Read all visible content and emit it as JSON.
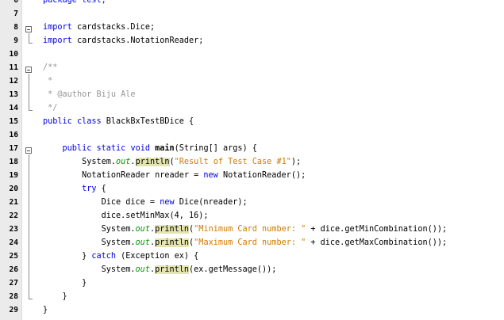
{
  "editor": {
    "lines": [
      {
        "n": "6",
        "tokens": [
          {
            "t": "package test;",
            "c": "kw-partial"
          }
        ]
      },
      {
        "n": "7",
        "tokens": []
      },
      {
        "n": "8",
        "tokens": [
          {
            "t": "import",
            "c": "kw"
          },
          {
            "t": " cardstacks.Dice;",
            "c": ""
          }
        ]
      },
      {
        "n": "9",
        "tokens": [
          {
            "t": "import",
            "c": "kw"
          },
          {
            "t": " cardstacks.NotationReader;",
            "c": ""
          }
        ]
      },
      {
        "n": "10",
        "tokens": []
      },
      {
        "n": "11",
        "tokens": [
          {
            "t": "/**",
            "c": "cmt"
          }
        ]
      },
      {
        "n": "12",
        "tokens": [
          {
            "t": " *",
            "c": "cmt"
          }
        ]
      },
      {
        "n": "13",
        "tokens": [
          {
            "t": " * ",
            "c": "cmt"
          },
          {
            "t": "@author",
            "c": "tag"
          },
          {
            "t": " Biju Ale",
            "c": "cmt"
          }
        ]
      },
      {
        "n": "14",
        "tokens": [
          {
            "t": " */",
            "c": "cmt"
          }
        ]
      },
      {
        "n": "15",
        "tokens": [
          {
            "t": "public",
            "c": "kw"
          },
          {
            "t": " ",
            "c": ""
          },
          {
            "t": "class",
            "c": "kw"
          },
          {
            "t": " BlackBxTestBDice {",
            "c": ""
          }
        ]
      },
      {
        "n": "16",
        "tokens": []
      },
      {
        "n": "17",
        "tokens": [
          {
            "t": "    public",
            "c": "kw"
          },
          {
            "t": " ",
            "c": ""
          },
          {
            "t": "static",
            "c": "kw"
          },
          {
            "t": " ",
            "c": ""
          },
          {
            "t": "void",
            "c": "kw"
          },
          {
            "t": " ",
            "c": ""
          },
          {
            "t": "main",
            "c": "bold"
          },
          {
            "t": "(String[] args) {",
            "c": ""
          }
        ]
      },
      {
        "n": "18",
        "tokens": [
          {
            "t": "        System.",
            "c": ""
          },
          {
            "t": "out",
            "c": "fld"
          },
          {
            "t": ".",
            "c": ""
          },
          {
            "t": "println",
            "c": "hl"
          },
          {
            "t": "(",
            "c": ""
          },
          {
            "t": "\"Result of Test Case #1\"",
            "c": "str"
          },
          {
            "t": ");",
            "c": ""
          }
        ]
      },
      {
        "n": "19",
        "tokens": [
          {
            "t": "        NotationReader nreader = ",
            "c": ""
          },
          {
            "t": "new",
            "c": "kw"
          },
          {
            "t": " NotationReader();",
            "c": ""
          }
        ]
      },
      {
        "n": "20",
        "tokens": [
          {
            "t": "        try",
            "c": "kw"
          },
          {
            "t": " {",
            "c": ""
          }
        ]
      },
      {
        "n": "21",
        "tokens": [
          {
            "t": "            Dice dice = ",
            "c": ""
          },
          {
            "t": "new",
            "c": "kw"
          },
          {
            "t": " Dice(nreader);",
            "c": ""
          }
        ]
      },
      {
        "n": "22",
        "tokens": [
          {
            "t": "            dice.setMinMax(4, 16);",
            "c": ""
          }
        ]
      },
      {
        "n": "23",
        "tokens": [
          {
            "t": "            System.",
            "c": ""
          },
          {
            "t": "out",
            "c": "fld"
          },
          {
            "t": ".",
            "c": ""
          },
          {
            "t": "println",
            "c": "hl"
          },
          {
            "t": "(",
            "c": ""
          },
          {
            "t": "\"Minimum Card number: \"",
            "c": "str"
          },
          {
            "t": " + dice.getMinCombination());",
            "c": ""
          }
        ]
      },
      {
        "n": "24",
        "tokens": [
          {
            "t": "            System.",
            "c": ""
          },
          {
            "t": "out",
            "c": "fld"
          },
          {
            "t": ".",
            "c": ""
          },
          {
            "t": "println",
            "c": "hl"
          },
          {
            "t": "(",
            "c": ""
          },
          {
            "t": "\"Maximum Card number: \"",
            "c": "str"
          },
          {
            "t": " + dice.getMaxCombination());",
            "c": ""
          }
        ]
      },
      {
        "n": "25",
        "tokens": [
          {
            "t": "        } ",
            "c": ""
          },
          {
            "t": "catch",
            "c": "kw"
          },
          {
            "t": " (Exception ex) {",
            "c": ""
          }
        ]
      },
      {
        "n": "26",
        "tokens": [
          {
            "t": "            System.",
            "c": ""
          },
          {
            "t": "out",
            "c": "fld"
          },
          {
            "t": ".",
            "c": ""
          },
          {
            "t": "println",
            "c": "hl"
          },
          {
            "t": "(ex.getMessage());",
            "c": ""
          }
        ]
      },
      {
        "n": "27",
        "tokens": [
          {
            "t": "        }",
            "c": ""
          }
        ]
      },
      {
        "n": "28",
        "tokens": [
          {
            "t": "    }",
            "c": ""
          }
        ]
      },
      {
        "n": "29",
        "tokens": [
          {
            "t": "}",
            "c": ""
          }
        ]
      }
    ]
  }
}
